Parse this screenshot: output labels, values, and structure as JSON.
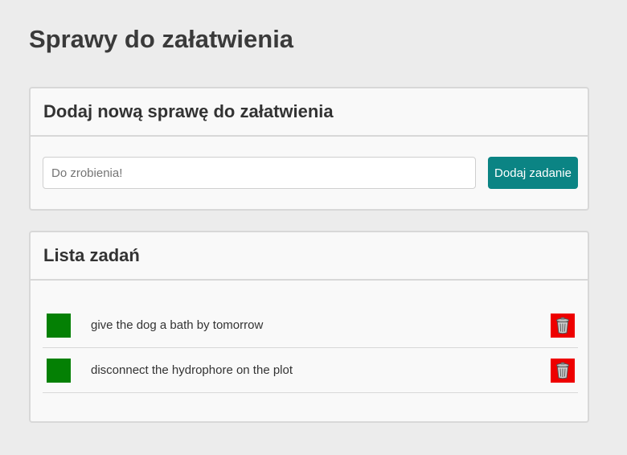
{
  "page": {
    "title": "Sprawy do załatwienia"
  },
  "add_section": {
    "heading": "Dodaj nową sprawę do załatwienia",
    "input_placeholder": "Do zrobienia!",
    "input_value": "",
    "button_label": "Dodaj zadanie"
  },
  "list_section": {
    "heading": "Lista zadań",
    "items": [
      {
        "text": "give the dog a bath by tomorrow",
        "toggle_icon": "green-square",
        "delete_icon": "trash-icon"
      },
      {
        "text": "disconnect the hydrophore on the plot",
        "toggle_icon": "green-square",
        "delete_icon": "trash-icon"
      }
    ]
  },
  "colors": {
    "background": "#ececec",
    "accent": "#0b8484",
    "done_toggle": "#048004",
    "delete": "#ee0000"
  }
}
